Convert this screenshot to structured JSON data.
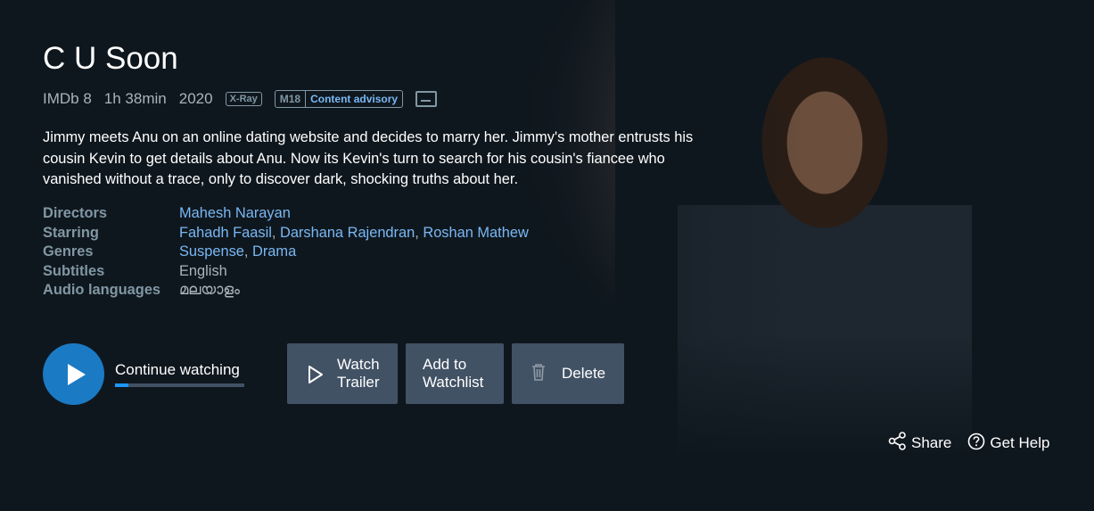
{
  "title": "C U Soon",
  "meta": {
    "imdb": "IMDb 8",
    "runtime": "1h 38min",
    "year": "2020",
    "xray": "X-Ray",
    "rating": "M18",
    "advisory": "Content advisory",
    "subtitles_icon": "subtitles-icon"
  },
  "synopsis": "Jimmy meets Anu on an online dating website and decides to marry her. Jimmy's mother entrusts his cousin Kevin to get details about Anu. Now its Kevin's turn to search for his cousin's fiancee who vanished without a trace, only to discover dark, shocking truths about her.",
  "details": {
    "directors_label": "Directors",
    "directors": [
      "Mahesh Narayan"
    ],
    "starring_label": "Starring",
    "starring": [
      "Fahadh Faasil",
      "Darshana Rajendran",
      "Roshan Mathew"
    ],
    "genres_label": "Genres",
    "genres": [
      "Suspense",
      "Drama"
    ],
    "subtitles_label": "Subtitles",
    "subtitles": "English",
    "audio_label": "Audio languages",
    "audio": "മലയാളം"
  },
  "actions": {
    "continue_label": "Continue watching",
    "progress": 0.1,
    "trailer_label_1": "Watch",
    "trailer_label_2": "Trailer",
    "watchlist_label_1": "Add to",
    "watchlist_label_2": "Watchlist",
    "delete_label": "Delete"
  },
  "footer": {
    "share_label": "Share",
    "help_label": "Get Help"
  },
  "colors": {
    "background": "#0f171e",
    "accent": "#1b7ac4",
    "link": "#79b8f3",
    "button": "#425265"
  }
}
